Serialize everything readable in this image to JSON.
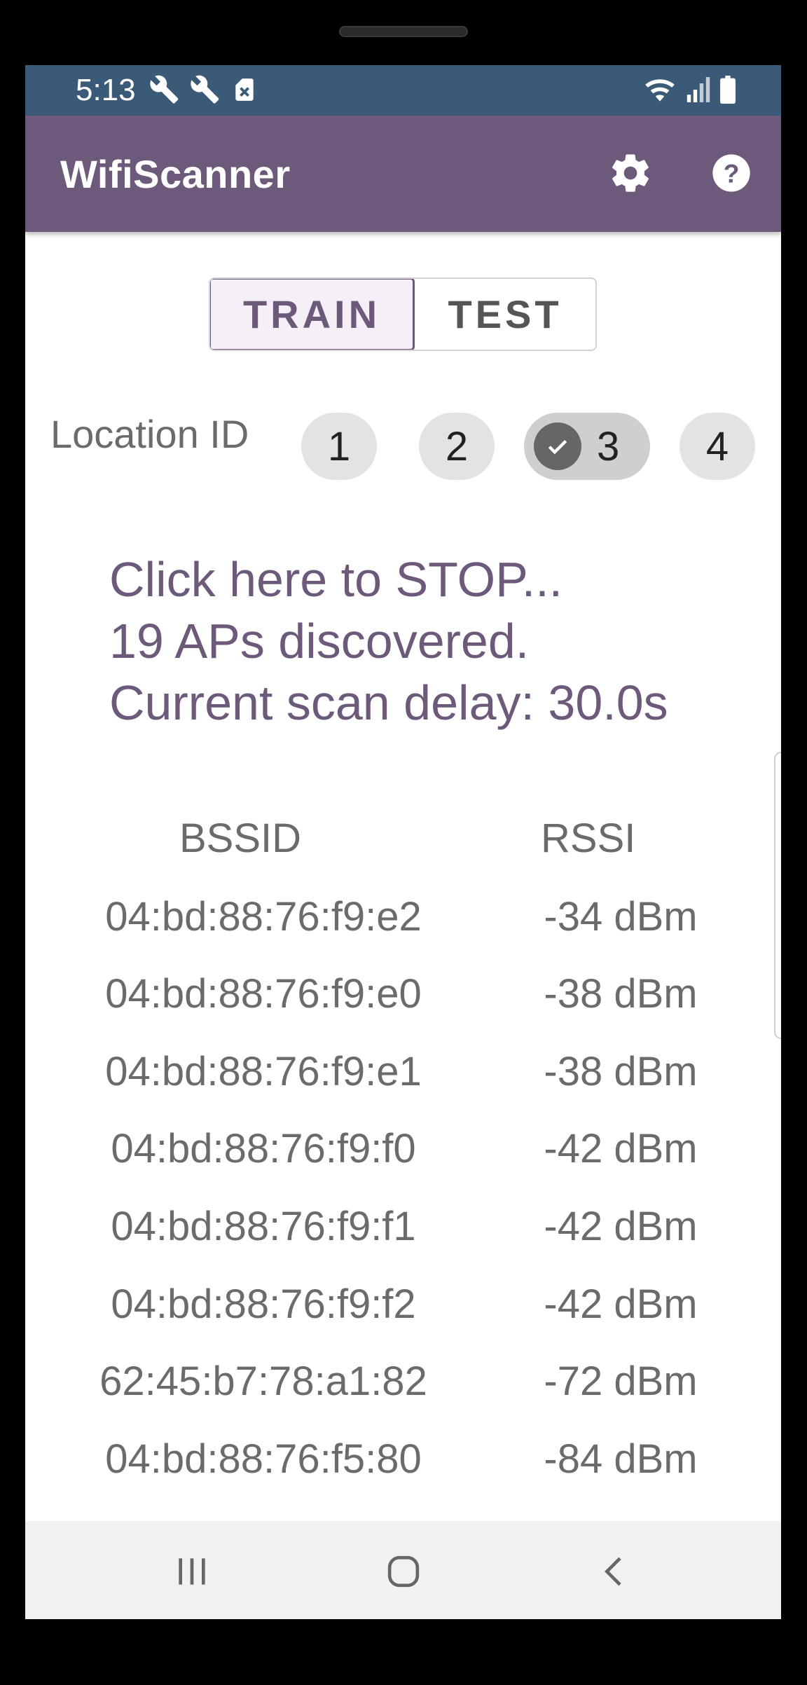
{
  "status_bar": {
    "time": "5:13",
    "left_icons": [
      "wrench-icon",
      "wrench-icon",
      "sim-error-icon"
    ],
    "right_icons": [
      "wifi-icon",
      "signal-icon",
      "battery-icon"
    ]
  },
  "app_bar": {
    "title": "WifiScanner",
    "actions": [
      "settings-icon",
      "help-icon"
    ],
    "color": "#6d5a7a"
  },
  "mode_toggle": {
    "options": [
      "TRAIN",
      "TEST"
    ],
    "selected": "TRAIN"
  },
  "location": {
    "label": "Location ID",
    "chips": [
      "1",
      "2",
      "3",
      "4"
    ],
    "selected": "3"
  },
  "message": {
    "line1": "Click here to STOP...",
    "line2": "19 APs discovered.",
    "line3": "Current scan delay: 30.0s"
  },
  "table": {
    "headers": {
      "bssid": "BSSID",
      "rssi": "RSSI"
    },
    "rows": [
      {
        "bssid": "04:bd:88:76:f9:e2",
        "rssi": "-34 dBm"
      },
      {
        "bssid": "04:bd:88:76:f9:e0",
        "rssi": "-38 dBm"
      },
      {
        "bssid": "04:bd:88:76:f9:e1",
        "rssi": "-38 dBm"
      },
      {
        "bssid": "04:bd:88:76:f9:f0",
        "rssi": "-42 dBm"
      },
      {
        "bssid": "04:bd:88:76:f9:f1",
        "rssi": "-42 dBm"
      },
      {
        "bssid": "04:bd:88:76:f9:f2",
        "rssi": "-42 dBm"
      },
      {
        "bssid": "62:45:b7:78:a1:82",
        "rssi": "-72 dBm"
      },
      {
        "bssid": "04:bd:88:76:f5:80",
        "rssi": "-84 dBm"
      }
    ]
  },
  "nav_bar": {
    "buttons": [
      "recents-icon",
      "home-icon",
      "back-icon"
    ]
  }
}
